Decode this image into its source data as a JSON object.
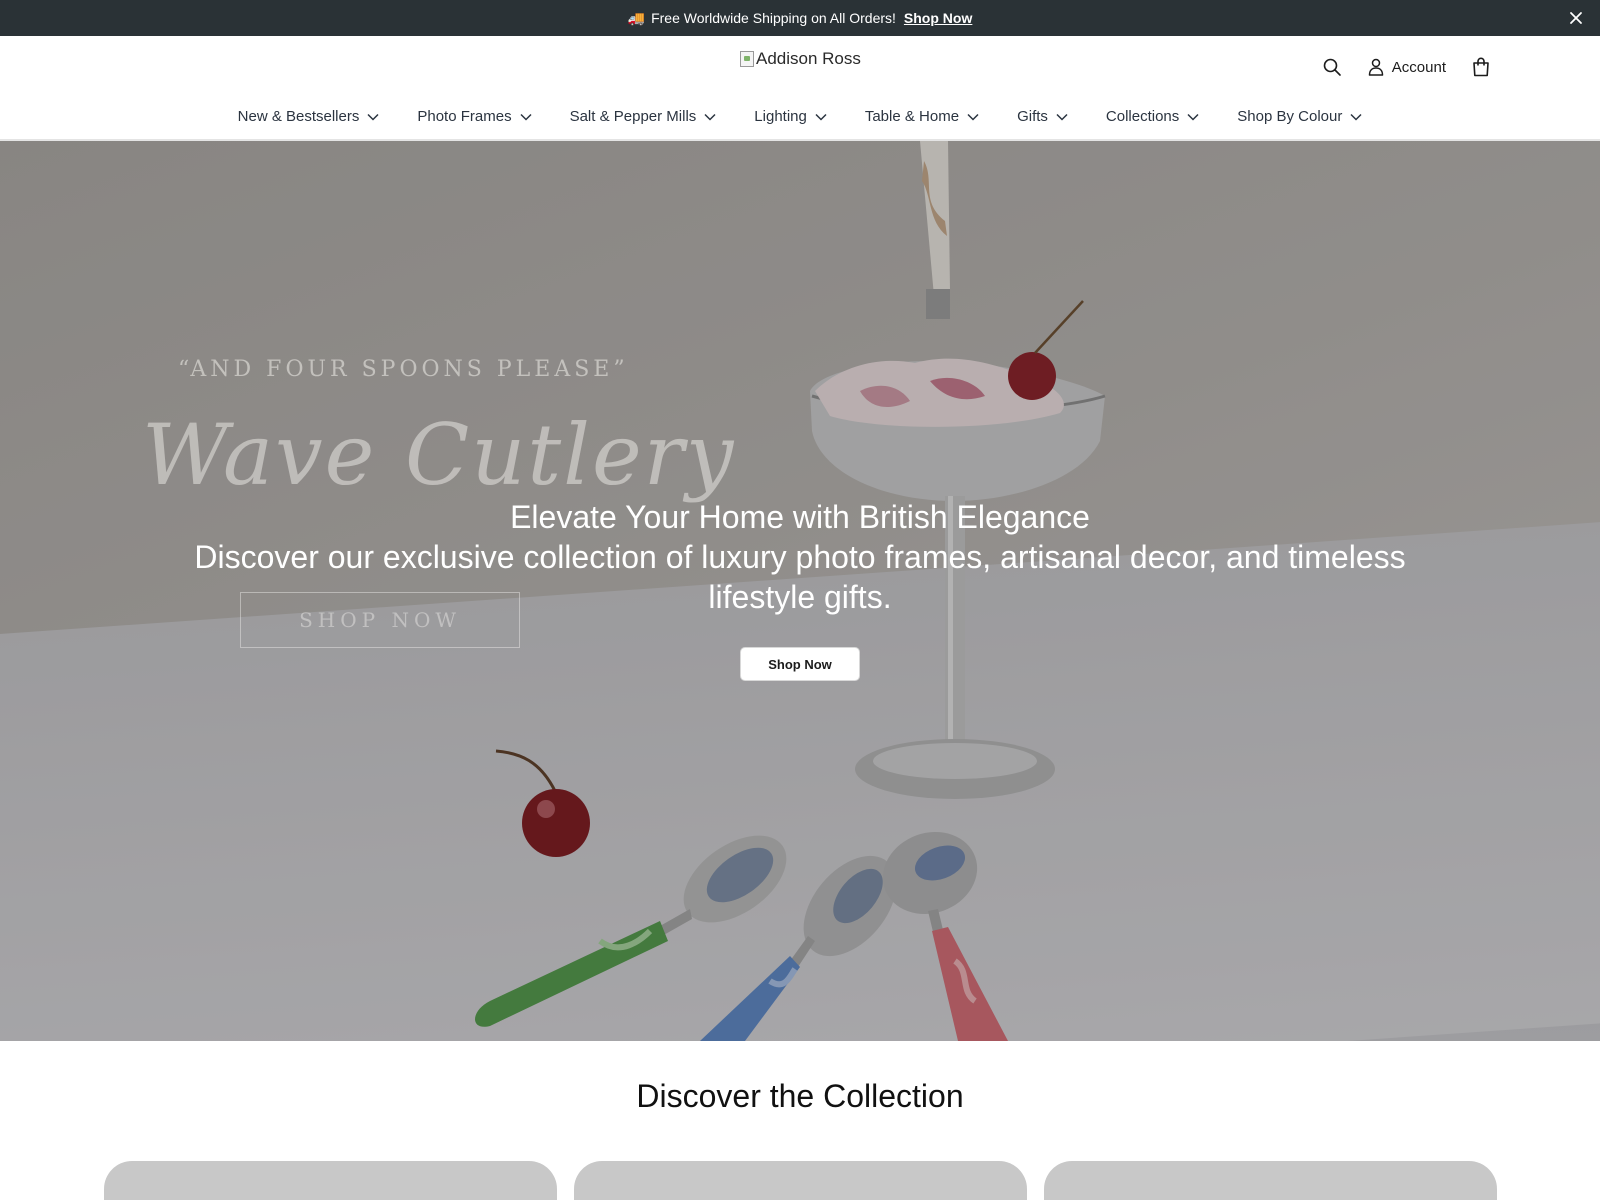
{
  "announcement": {
    "icon": "truck-icon",
    "text": "Free Worldwide Shipping on All Orders!",
    "link_label": "Shop Now"
  },
  "header": {
    "logo_alt": "Addison Ross",
    "account_label": "Account"
  },
  "nav": {
    "items": [
      {
        "label": "New & Bestsellers"
      },
      {
        "label": "Photo Frames"
      },
      {
        "label": "Salt & Pepper Mills"
      },
      {
        "label": "Lighting"
      },
      {
        "label": "Table & Home"
      },
      {
        "label": "Gifts"
      },
      {
        "label": "Collections"
      },
      {
        "label": "Shop By Colour"
      }
    ]
  },
  "hero": {
    "image_subtitle": "“AND FOUR SPOONS PLEASE”",
    "image_title": "Wave Cutlery",
    "image_button": "SHOP NOW",
    "title": "Elevate Your Home with British Elegance",
    "description": "Discover our exclusive collection of luxury photo frames, artisanal decor, and timeless lifestyle gifts.",
    "button_label": "Shop Now"
  },
  "collection": {
    "title": "Discover the Collection"
  },
  "colors": {
    "announcement_bg": "#2a3236",
    "nav_text": "#2b3440",
    "card_placeholder": "#c8c8c8"
  }
}
